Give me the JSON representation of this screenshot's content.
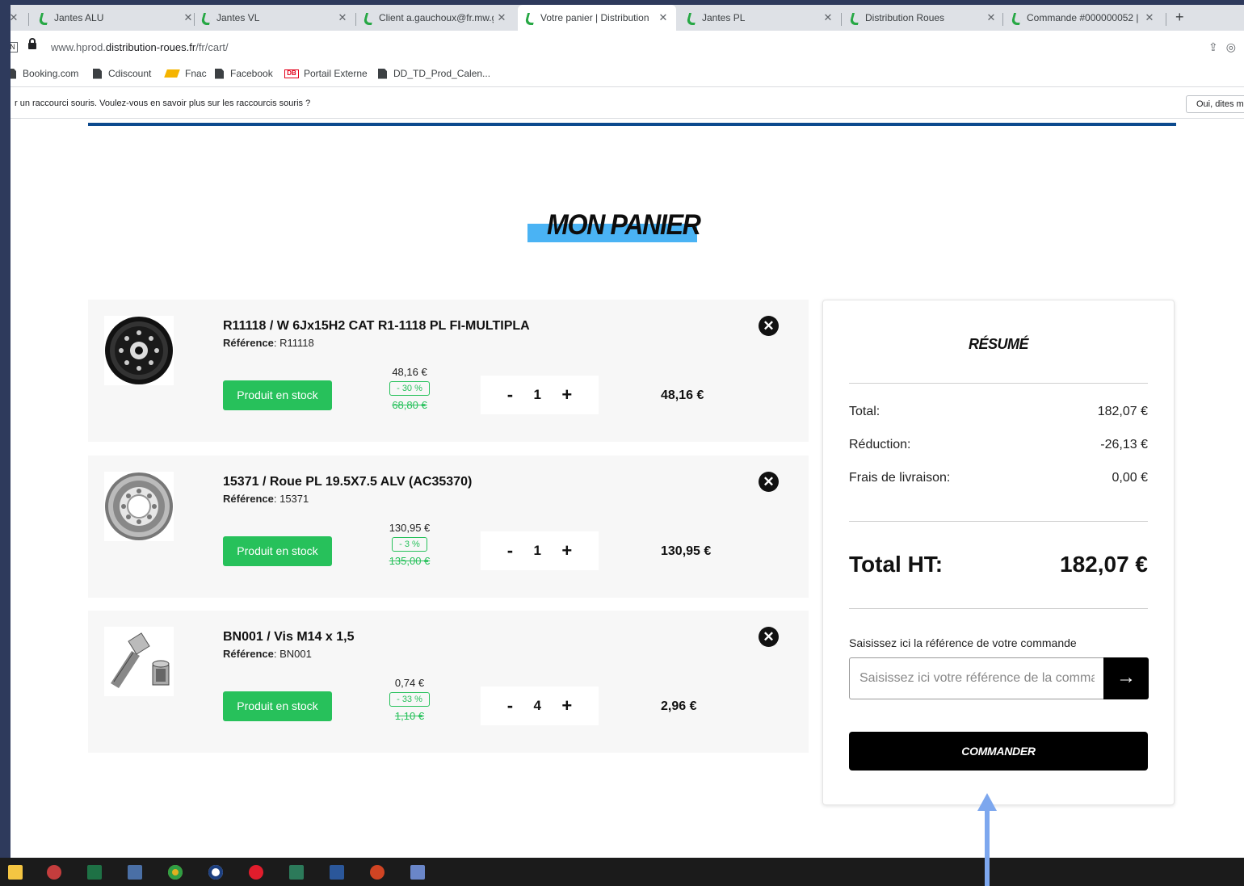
{
  "browser": {
    "tabs": [
      {
        "title": "Jantes ALU",
        "active": false
      },
      {
        "title": "Jantes VL",
        "active": false
      },
      {
        "title": "Client a.gauchoux@fr.mw.g",
        "active": false
      },
      {
        "title": "Votre panier | Distribution",
        "active": true
      },
      {
        "title": "Jantes PL",
        "active": false
      },
      {
        "title": "Distribution Roues",
        "active": false
      },
      {
        "title": "Commande #000000052 |",
        "active": false
      }
    ],
    "close_glyph": "✕",
    "new_tab_glyph": "+",
    "url_prefix": "www.hprod.",
    "url_host": "distribution-roues.fr",
    "url_path": "/fr/cart/",
    "url_badge": "N",
    "bookmarks": [
      {
        "label": "Booking.com",
        "icon": "page-icon"
      },
      {
        "label": "Cdiscount",
        "icon": "page-icon"
      },
      {
        "label": "Fnac",
        "icon": "fnac-icon"
      },
      {
        "label": "Facebook",
        "icon": "page-icon"
      },
      {
        "label": "Portail Externe",
        "icon": "db-icon",
        "badge": "DB"
      },
      {
        "label": "DD_TD_Prod_Calen...",
        "icon": "page-icon"
      }
    ],
    "infobar_message": "r un raccourci souris. Voulez-vous en savoir plus sur les raccourcis souris ?",
    "infobar_button": "Oui, dites m"
  },
  "page": {
    "title": "MON PANIER",
    "items": [
      {
        "name": "R11118 / W 6Jx15H2 CAT R1-1118 PL FI-MULTIPLA",
        "ref_label": "Référence",
        "ref": ": R11118",
        "stock": "Produit en stock",
        "unit_price": "48,16 €",
        "discount": "- 30 %",
        "old_price": "68,80 €",
        "qty": "1",
        "total": "48,16 €",
        "thumb": "steel-wheel"
      },
      {
        "name": "15371 / Roue PL 19.5X7.5 ALV (AC35370)",
        "ref_label": "Référence",
        "ref": ": 15371",
        "stock": "Produit en stock",
        "unit_price": "130,95 €",
        "discount": "- 3 %",
        "old_price": "135,00 €",
        "qty": "1",
        "total": "130,95 €",
        "thumb": "truck-wheel"
      },
      {
        "name": "BN001 / Vis M14 x 1,5",
        "ref_label": "Référence",
        "ref": ": BN001",
        "stock": "Produit en stock",
        "unit_price": "0,74 €",
        "discount": "- 33 %",
        "old_price": "1,10 €",
        "qty": "4",
        "total": "2,96 €",
        "thumb": "lug-bolt"
      }
    ],
    "qty_minus": "-",
    "qty_plus": "+",
    "remove_glyph": "✕",
    "summary": {
      "title": "RÉSUMÉ",
      "rows": [
        {
          "label": "Total:",
          "value": "182,07 €"
        },
        {
          "label": "Réduction:",
          "value": "-26,13 €"
        },
        {
          "label": "Frais de livraison:",
          "value": "0,00 €"
        }
      ],
      "total_label": "Total HT:",
      "total_value": "182,07 €",
      "ref_label": "Saisissez ici la référence de votre commande",
      "ref_placeholder": "Saisissez ici votre référence de la commande",
      "submit_glyph": "→",
      "order_button": "COMMANDER"
    }
  },
  "colors": {
    "stock_green": "#27c15b",
    "title_highlight": "#4ab3f4",
    "topline_blue": "#0c4a8e",
    "annotation_arrow": "#7da7ee"
  }
}
